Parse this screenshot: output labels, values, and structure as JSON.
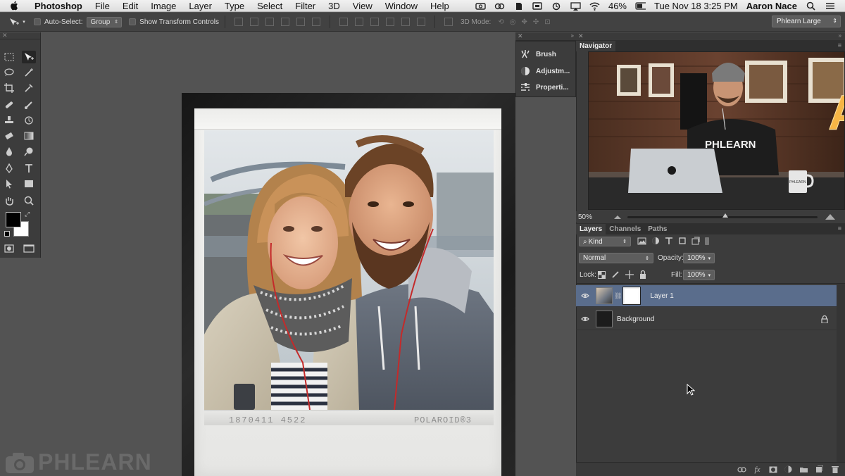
{
  "menubar": {
    "items": [
      "Photoshop",
      "File",
      "Edit",
      "Image",
      "Layer",
      "Type",
      "Select",
      "Filter",
      "3D",
      "View",
      "Window",
      "Help"
    ],
    "battery": "46%",
    "clock": "Tue Nov 18  3:25 PM",
    "user": "Aaron Nace"
  },
  "options": {
    "auto_select": "Auto-Select:",
    "auto_select_target": "Group",
    "show_transform": "Show Transform Controls",
    "mode3d": "3D Mode:",
    "workspace": "Phlearn Large"
  },
  "collapsed_panels": [
    "Brush",
    "Adjustm...",
    "Properti..."
  ],
  "navigator": {
    "tab": "Navigator",
    "zoom": "50%"
  },
  "layers_panel": {
    "tabs": [
      "Layers",
      "Channels",
      "Paths"
    ],
    "filter": "Kind",
    "blend_mode": "Normal",
    "opacity_label": "Opacity:",
    "opacity_value": "100%",
    "lock_label": "Lock:",
    "fill_label": "Fill:",
    "fill_value": "100%",
    "layers": [
      {
        "name": "Layer 1",
        "selected": true
      },
      {
        "name": "Background",
        "selected": false
      }
    ]
  },
  "document": {
    "film_number": "1870411 4522",
    "film_brand": "POLAROID®3"
  },
  "watermark": "PHLEARN",
  "navigator_scene": {
    "shirt_text": "PHLEARN",
    "mug_text": "PHLEARN",
    "sign_letter": "A"
  },
  "colors": {
    "selected_layer": "#5a6d8c",
    "panel_bg": "#3c3c3c",
    "canvas_bg": "#535353",
    "menubar": "#e9e9e9"
  }
}
